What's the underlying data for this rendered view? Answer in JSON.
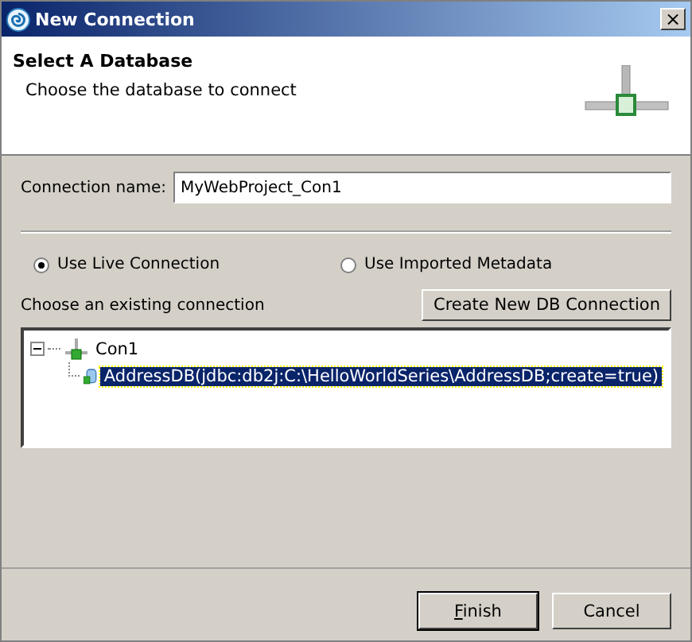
{
  "window": {
    "title": "New Connection",
    "close": "×"
  },
  "header": {
    "title": "Select A Database",
    "description": "Choose the database to connect"
  },
  "connection_name": {
    "label": "Connection name:",
    "value": "MyWebProject_Con1"
  },
  "source_options": [
    {
      "label": "Use Live Connection",
      "selected": true
    },
    {
      "label": "Use Imported Metadata",
      "selected": false
    }
  ],
  "existing_label": "Choose an existing connection",
  "create_button": "Create New DB Connection",
  "tree": [
    {
      "label": "Con1",
      "kind": "connection",
      "expanded": true,
      "selected": false,
      "children": [
        {
          "label": "AddressDB(jdbc:db2j:C:\\HelloWorldSeries\\AddressDB;create=true)",
          "kind": "database",
          "selected": true
        }
      ]
    }
  ],
  "buttons": [
    {
      "label": "Finish",
      "default": true,
      "mnemonic": true
    },
    {
      "label": "Cancel",
      "default": false,
      "mnemonic": false
    }
  ]
}
